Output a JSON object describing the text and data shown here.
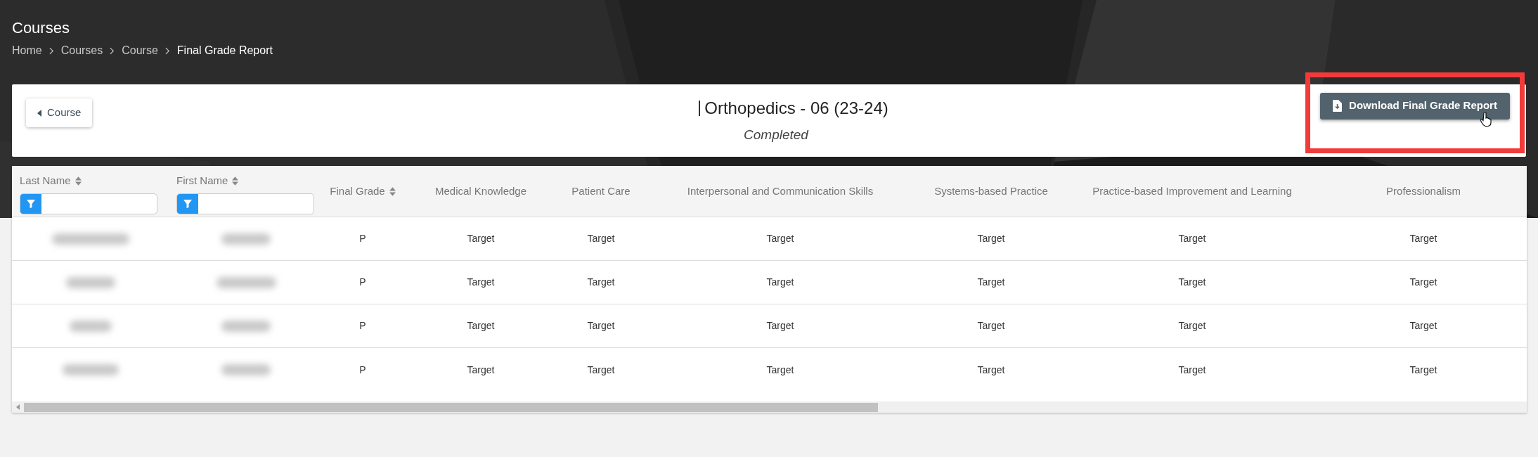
{
  "page_title": "Courses",
  "breadcrumbs": [
    {
      "label": "Home",
      "current": false
    },
    {
      "label": "Courses",
      "current": false
    },
    {
      "label": "Course",
      "current": false
    },
    {
      "label": "Final Grade Report",
      "current": true
    }
  ],
  "back_button": {
    "label": "Course"
  },
  "course": {
    "title": "Orthopedics - 06 (23-24)",
    "status": "Completed"
  },
  "download_button": {
    "label": "Download Final Grade Report",
    "highlighted": true
  },
  "table": {
    "columns": [
      {
        "label": "Last Name",
        "sortable": true,
        "filter": true
      },
      {
        "label": "First Name",
        "sortable": true,
        "filter": true
      },
      {
        "label": "Final Grade",
        "sortable": true,
        "filter": false
      },
      {
        "label": "Medical Knowledge",
        "sortable": false,
        "filter": false
      },
      {
        "label": "Patient Care",
        "sortable": false,
        "filter": false
      },
      {
        "label": "Interpersonal and Communication Skills",
        "sortable": false,
        "filter": false
      },
      {
        "label": "Systems-based Practice",
        "sortable": false,
        "filter": false
      },
      {
        "label": "Practice-based Improvement and Learning",
        "sortable": false,
        "filter": false
      },
      {
        "label": "Professionalism",
        "sortable": false,
        "filter": false
      }
    ],
    "rows": [
      {
        "cells": [
          "",
          "",
          "P",
          "Target",
          "Target",
          "Target",
          "Target",
          "Target",
          "Target"
        ]
      },
      {
        "cells": [
          "",
          "",
          "P",
          "Target",
          "Target",
          "Target",
          "Target",
          "Target",
          "Target"
        ]
      },
      {
        "cells": [
          "",
          "",
          "P",
          "Target",
          "Target",
          "Target",
          "Target",
          "Target",
          "Target"
        ]
      },
      {
        "cells": [
          "",
          "",
          "P",
          "Target",
          "Target",
          "Target",
          "Target",
          "Target",
          "Target"
        ]
      }
    ]
  }
}
